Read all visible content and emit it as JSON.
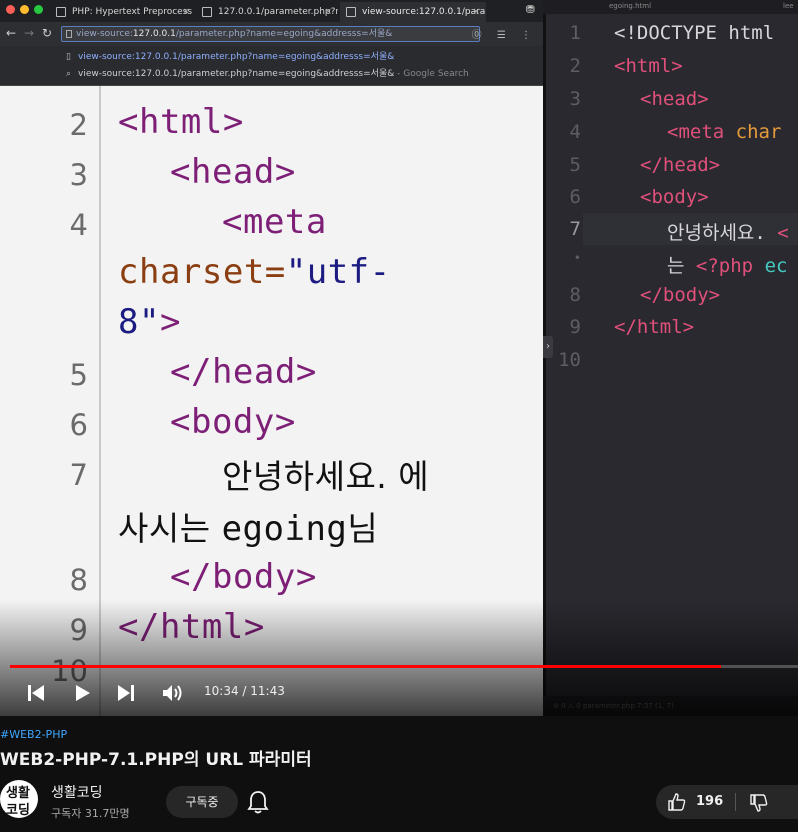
{
  "browser": {
    "tabs": [
      {
        "label": "PHP: Hypertext Preprocess"
      },
      {
        "label": "127.0.0.1/parameter.php?nam"
      },
      {
        "label": "view-source:127.0.0.1/paramı"
      }
    ],
    "address_prefix": "view-source:",
    "address_host": "127.0.0.1",
    "address_rest": "/parameter.php?name=egoing&addresss=서울&",
    "suggestions": [
      {
        "text": "view-source:127.0.0.1/parameter.php?name=egoing&addresss=서울&",
        "suffix": ""
      },
      {
        "text": "view-source:127.0.0.1/parameter.php?name=egoing&addresss=서울&",
        "suffix": " - Google Search"
      }
    ]
  },
  "source_view": {
    "line_numbers": [
      "2",
      "3",
      "4",
      "5",
      "6",
      "7",
      "8",
      "9",
      "10"
    ],
    "code": {
      "l2": "<html>",
      "l3": "<head>",
      "l4a": "<meta",
      "l4b_attr": "charset=",
      "l4b_str": "\"utf-",
      "l4c_str": "8\"",
      "l4c_tag": ">",
      "l5": "</head>",
      "l6": "<body>",
      "l7a": "안녕하세요. 에",
      "l7b_ko1": "사시는 ",
      "l7b_en": "egoing",
      "l7b_ko2": "님",
      "l8": "</body>",
      "l9": "</html>"
    }
  },
  "editor": {
    "tabs_left": "egoing.html",
    "tabs_right": "lee",
    "line_numbers": [
      "1",
      "2",
      "3",
      "4",
      "5",
      "6",
      "7",
      "•",
      "8",
      "9",
      "10"
    ],
    "lines": {
      "l1": "<!DOCTYPE html",
      "l2": "<html>",
      "l3": "<head>",
      "l4_tag": "<meta",
      "l4_attr": " char",
      "l5": "</head>",
      "l6": "<body>",
      "l7_text": "안녕하세요. ",
      "l7_tag": "<",
      "l7w_text": "는 ",
      "l7w_php": "<?php",
      "l7w_rest": " ec",
      "l8": "</body>",
      "l9": "</html>"
    },
    "status": "⊘ 0  ⚠ 0     parameter.php     7:37     (1, 7)"
  },
  "player": {
    "current_time": "10:34",
    "duration": "11:43",
    "time_display": "10:34 / 11:43",
    "progress_fraction": 0.902
  },
  "video_info": {
    "hashtag": "#WEB2-PHP",
    "title": "WEB2-PHP-7.1.PHP의 URL 파라미터",
    "channel_name": "생활코딩",
    "subscribers": "구독자 31.7만명",
    "subscribe_label": "구독중",
    "likes": "196",
    "avatar_text": [
      "생활",
      "코딩"
    ]
  },
  "colors": {
    "accent_progress": "#ff0000",
    "hashtag": "#3ea6ff",
    "html_tag": "#7d1f76",
    "editor_tag": "#e0507a"
  }
}
